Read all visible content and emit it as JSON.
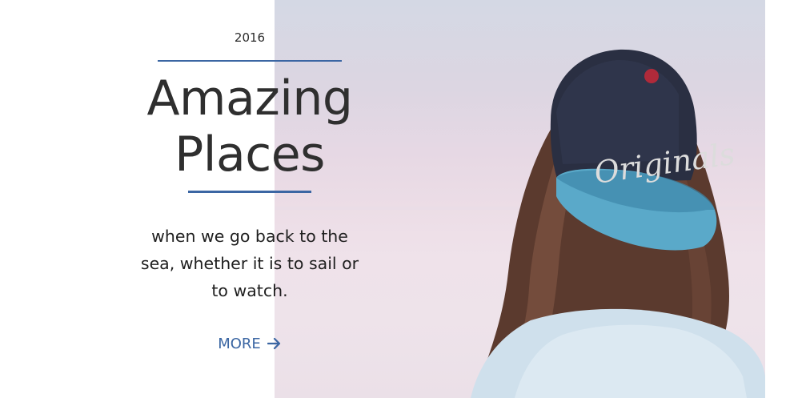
{
  "hero": {
    "year": "2016",
    "title_line1": "Amazing",
    "title_line2": "Places",
    "tagline_line1": "when we go back to the",
    "tagline_line2": "sea, whether it is to sail or",
    "tagline_line3": "to watch.",
    "more_label": "MORE",
    "more_icon": "arrow-right-icon"
  },
  "photo": {
    "cap_text": "Originals"
  },
  "colors": {
    "accent": "#3b66a3",
    "text": "#2f2f2f",
    "background": "#ffffff"
  }
}
